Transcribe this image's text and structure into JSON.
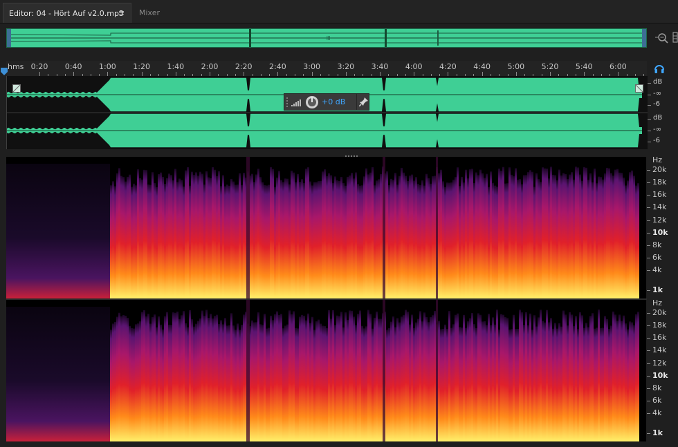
{
  "tabs": {
    "editor_label": "Editor: 04 - Hört Auf v2.0.mp3",
    "menu_icon": "≡",
    "mixer_label": "Mixer"
  },
  "ruler": {
    "unit": "hms",
    "ticks": [
      "0:20",
      "0:40",
      "1:00",
      "1:20",
      "1:40",
      "2:00",
      "2:20",
      "2:40",
      "3:00",
      "3:20",
      "3:40",
      "4:00",
      "4:20",
      "4:40",
      "5:00",
      "5:20",
      "5:40",
      "6:00"
    ]
  },
  "waveform": {
    "channels": [
      {
        "db_labels": {
          "unit": "dB",
          "inf": "-∞",
          "neg6": "-6"
        }
      },
      {
        "db_labels": {
          "unit": "dB",
          "inf": "-∞",
          "neg6": "-6"
        }
      }
    ]
  },
  "clip_gain": {
    "value": "+0 dB"
  },
  "spectral": {
    "channels": [
      {
        "unit": "Hz",
        "labels": [
          "20k",
          "18k",
          "16k",
          "14k",
          "12k",
          "10k",
          "8k",
          "6k",
          "4k",
          "1k"
        ]
      },
      {
        "unit": "Hz",
        "labels": [
          "20k",
          "18k",
          "16k",
          "14k",
          "12k",
          "10k",
          "8k",
          "6k",
          "4k",
          "1k"
        ]
      }
    ]
  },
  "colors": {
    "waveform": "#3fcf95",
    "accent": "#3fa7ff"
  },
  "icons": [
    "zoom-icon",
    "panel-icon",
    "headphone-icon",
    "playhead-icon",
    "pin-icon",
    "knob-icon",
    "fade-handle-icon"
  ]
}
